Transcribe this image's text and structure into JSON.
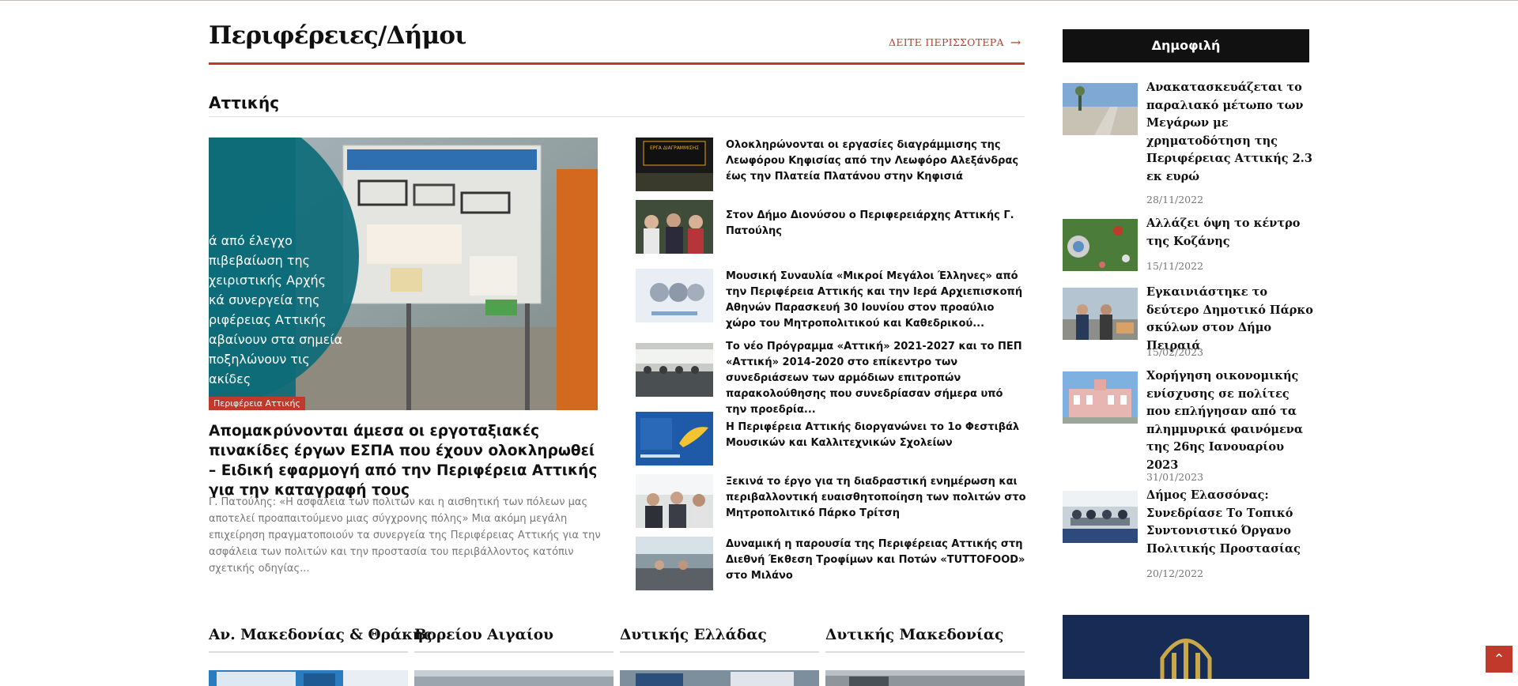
{
  "section": {
    "title": "Περιφέρειες/Δήμοι",
    "more_label": "ΔΕΙΤΕ ΠΕΡΙΣΣΟΤΕΡΑ",
    "sub_title": "Αττικής"
  },
  "featured": {
    "badge": "Περιφέρεια Αττικής",
    "title": "Απομακρύνονται άμεσα οι εργοταξιακές πινακίδες έργων ΕΣΠΑ που έχουν ολοκληρωθεί – Ειδική εφαρμογή από την Περιφέρεια Αττικής για την καταγραφή τους",
    "description": "Γ. Πατούλης: «Η ασφάλεια των πολιτών και η αισθητική των πόλεων μας αποτελεί προαπαιτούμενο μιας σύγχρονης πόλης» Μια ακόμη μεγάλη επιχείρηση πραγματοποιούν τα συνεργεία της Περιφέρειας Αττικής για την ασφάλεια των πολιτών και την προστασία του περιβάλλοντος κατόπιν σχετικής οδηγίας...",
    "image_text": [
      "ά από έλεγχο",
      "πιβεβαίωση της",
      "χειριστικής Αρχής",
      "κά συνεργεία της",
      "ριφέρειας Αττικής",
      "αβαίνουν στα σημεία",
      "ποξηλώνουν τις",
      "ακίδες"
    ]
  },
  "list": [
    {
      "title": "Ολοκληρώνονται οι εργασίες διαγράμμισης της Λεωφόρου Κηφισίας από την Λεωφόρο Αλεξάνδρας έως την Πλατεία Πλατάνου στην Κηφισιά",
      "thumb_text": "ΕΡΓΑ ΔΙΑΓΡΑΜΜΙΣΗΣ"
    },
    {
      "title": "Στον Δήμο Διονύσου ο Περιφερειάρχης Αττικής Γ. Πατούλης"
    },
    {
      "title": "Μουσική Συναυλία «Μικροί Μεγάλοι Έλληνες» από την Περιφέρεια Αττικής και την Ιερά Αρχιεπισκοπή Αθηνών Παρασκευή 30 Ιουνίου στον προαύλιο χώρο του Μητροπολιτικού και Καθεδρικού..."
    },
    {
      "title": "Το νέο Πρόγραμμα «Αττική» 2021-2027 και το ΠΕΠ «Αττική» 2014-2020 στο επίκεντρο των συνεδριάσεων των αρμόδιων επιτροπών παρακολούθησης που συνεδρίασαν σήμερα υπό την προεδρία..."
    },
    {
      "title": "Η Περιφέρεια Αττικής διοργανώνει το 1ο Φεστιβάλ Μουσικών και Καλλιτεχνικών Σχολείων"
    },
    {
      "title": "Ξεκινά το έργο για τη διαδραστική ενημέρωση και περιβαλλοντική ευαισθητοποίηση των πολιτών στο Μητροπολιτικό Πάρκο Τρίτση"
    },
    {
      "title": "Δυναμική η παρουσία της Περιφέρειας Αττικής στη Διεθνή Έκθεση Τροφίμων και Ποτών «TUTTOFOOD» στο Μιλάνο"
    }
  ],
  "sidebar": {
    "heading": "Δημοφιλή",
    "items": [
      {
        "title": "Ανακατασκευάζεται το παραλιακό μέτωπο των Μεγάρων με χρηματοδότηση της Περιφέρειας Αττικής 2.3 εκ ευρώ",
        "date": "28/11/2022"
      },
      {
        "title": "Αλλάζει όψη το κέντρο της Κοζάνης",
        "date": "15/11/2022"
      },
      {
        "title": "Εγκαινιάστηκε το δεύτερο Δημοτικό Πάρκο σκύλων στον Δήμο Πειραιά",
        "date": "15/02/2023"
      },
      {
        "title": "Χορήγηση οικονομικής ενίσχυσης σε πολίτες που επλήγησαν από τα πλημμυρικά φαινόμενα της 26ης Ιανουαρίου 2023",
        "date": "31/01/2023"
      },
      {
        "title": "Δήμος Ελασσόνας: Συνεδρίασε Το Τοπικό Συντονιστικό Όργανο Πολιτικής Προστασίας",
        "date": "20/12/2022"
      }
    ]
  },
  "categories": [
    {
      "title": "Αν. Μακεδονίας & Θράκης"
    },
    {
      "title": "Βορείου Αιγαίου"
    },
    {
      "title": "Δυτικής Ελλάδας"
    },
    {
      "title": "Δυτικής Μακεδονίας"
    }
  ],
  "colors": {
    "accent": "#c0392b",
    "sidebar_head_bg": "#111111",
    "banner_bg": "#172b54"
  },
  "icons": {
    "more_arrow": "arrow-right-icon",
    "scroll_top": "chevron-up-icon"
  }
}
